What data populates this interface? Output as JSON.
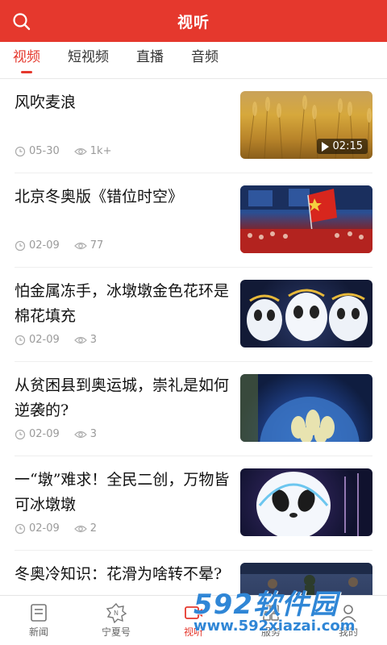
{
  "header": {
    "title": "视听",
    "search_icon": "search-icon"
  },
  "tabs": [
    {
      "label": "视频",
      "active": true
    },
    {
      "label": "短视频",
      "active": false
    },
    {
      "label": "直播",
      "active": false
    },
    {
      "label": "音频",
      "active": false
    }
  ],
  "feed": [
    {
      "title": "风吹麦浪",
      "date": "05-30",
      "views": "1k+",
      "duration": "02:15"
    },
    {
      "title": "北京冬奥版《错位时空》",
      "date": "02-09",
      "views": "77"
    },
    {
      "title": "怕金属冻手，冰墩墩金色花环是棉花填充",
      "date": "02-09",
      "views": "3"
    },
    {
      "title": "从贫困县到奥运城，崇礼是如何逆袭的?",
      "date": "02-09",
      "views": "3"
    },
    {
      "title": "一“墩”难求！全民二创，万物皆可冰墩墩",
      "date": "02-09",
      "views": "2"
    },
    {
      "title": "冬奥冷知识：花滑为啥转不晕?",
      "date": "",
      "views": ""
    }
  ],
  "bottom_nav": [
    {
      "label": "新闻",
      "icon": "news-icon",
      "active": false
    },
    {
      "label": "宁夏号",
      "icon": "ningxia-hao-icon",
      "active": false
    },
    {
      "label": "视听",
      "icon": "video-icon",
      "active": true
    },
    {
      "label": "服务",
      "icon": "service-icon",
      "active": false
    },
    {
      "label": "我的",
      "icon": "profile-icon",
      "active": false
    }
  ],
  "watermark": {
    "brand": "592软件园",
    "url": "www.592xiazai.com"
  },
  "colors": {
    "accent": "#e5382d",
    "meta_text": "#9a9a9a",
    "watermark": "#2f86d6"
  }
}
